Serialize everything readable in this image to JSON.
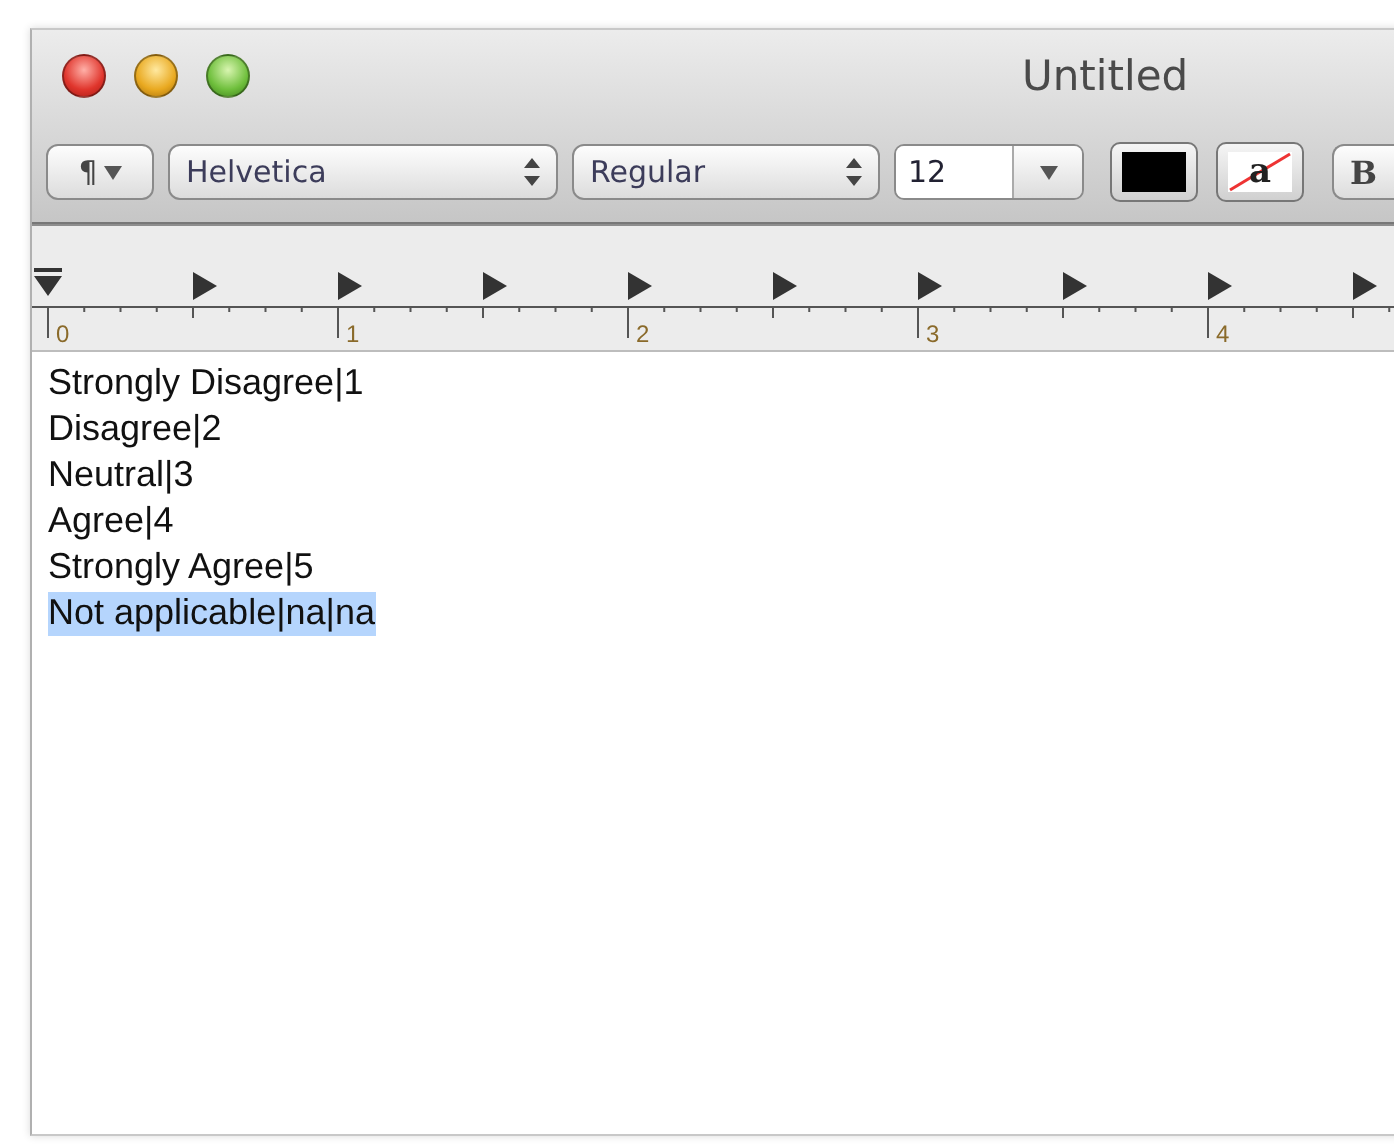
{
  "window": {
    "title": "Untitled"
  },
  "toolbar": {
    "paragraph_button": "¶",
    "font_family": "Helvetica",
    "font_style": "Regular",
    "font_size": "12",
    "bold_button": "B",
    "background_swatch": "a"
  },
  "ruler": {
    "labels": [
      "0",
      "1",
      "2",
      "3",
      "4"
    ]
  },
  "document": {
    "lines": [
      {
        "text": "Strongly Disagree|1",
        "selected": false
      },
      {
        "text": "Disagree|2",
        "selected": false
      },
      {
        "text": "Neutral|3",
        "selected": false
      },
      {
        "text": "Agree|4",
        "selected": false
      },
      {
        "text": "Strongly Agree|5",
        "selected": false
      },
      {
        "text": "Not applicable|na|na",
        "selected": true
      }
    ]
  }
}
